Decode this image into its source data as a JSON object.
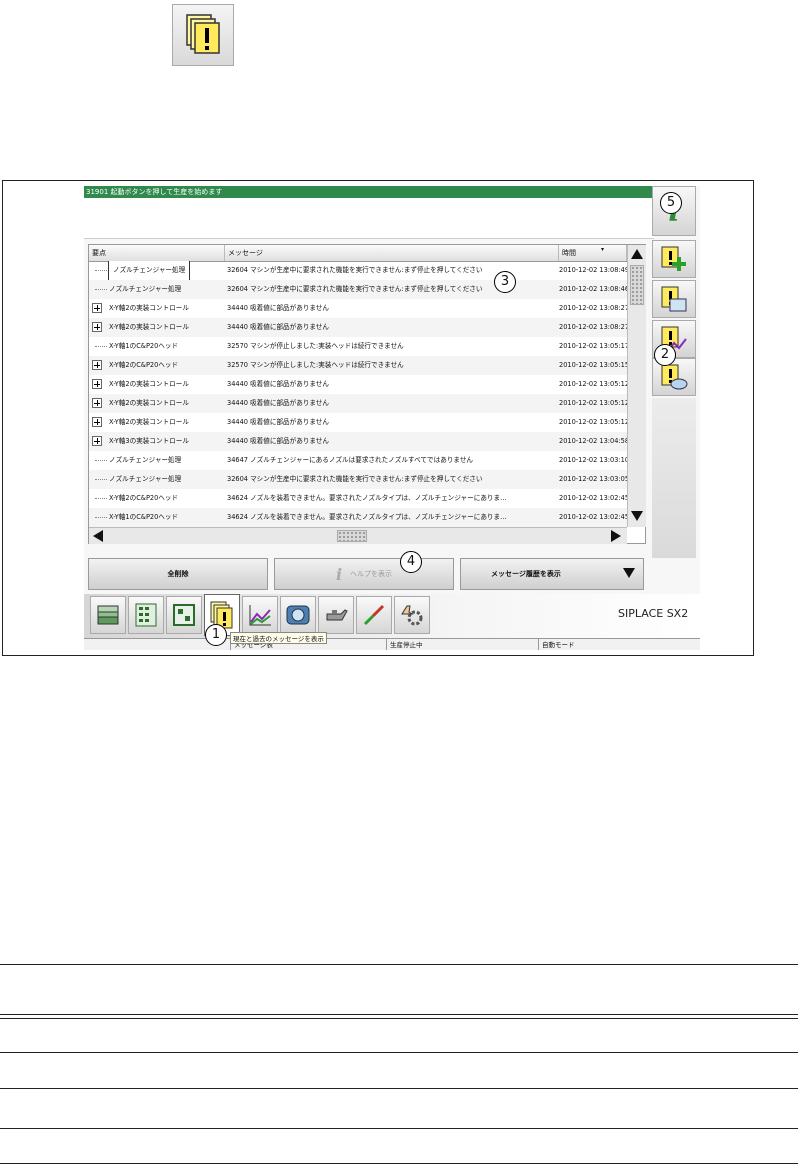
{
  "header_message": "31901 起動ボタンを押して生産を始めます",
  "table": {
    "columns": {
      "source": "要点",
      "message": "メッセージ",
      "time": "時間"
    },
    "rows": [
      {
        "expandable": false,
        "source": "ノズルチェンジャー処理",
        "message": "32604 マシンが生産中に要求された機能を実行できません:まず停止を押してください",
        "time": "2010-12-02 13:08:49",
        "selected": true
      },
      {
        "expandable": false,
        "source": "ノズルチェンジャー処理",
        "message": "32604 マシンが生産中に要求された機能を実行できません:まず停止を押してください",
        "time": "2010-12-02 13:08:46"
      },
      {
        "expandable": true,
        "source": "X-Y軸2の実装コントロール",
        "message": "34440 吸着値に部品がありません",
        "time": "2010-12-02 13:08:27"
      },
      {
        "expandable": true,
        "source": "X-Y軸2の実装コントロール",
        "message": "34440 吸着値に部品がありません",
        "time": "2010-12-02 13:08:27"
      },
      {
        "expandable": false,
        "source": "X-Y軸1のC&P20ヘッド",
        "message": "32570 マシンが停止しました:実装ヘッドは続行できません",
        "time": "2010-12-02 13:05:17"
      },
      {
        "expandable": true,
        "source": "X-Y軸2のC&P20ヘッド",
        "message": "32570 マシンが停止しました:実装ヘッドは続行できません",
        "time": "2010-12-02 13:05:15"
      },
      {
        "expandable": true,
        "source": "X-Y軸2の実装コントロール",
        "message": "34440 吸着値に部品がありません",
        "time": "2010-12-02 13:05:12"
      },
      {
        "expandable": true,
        "source": "X-Y軸2の実装コントロール",
        "message": "34440 吸着値に部品がありません",
        "time": "2010-12-02 13:05:12"
      },
      {
        "expandable": true,
        "source": "X-Y軸2の実装コントロール",
        "message": "34440 吸着値に部品がありません",
        "time": "2010-12-02 13:05:12"
      },
      {
        "expandable": true,
        "source": "X-Y軸3の実装コントロール",
        "message": "34440 吸着値に部品がありません",
        "time": "2010-12-02 13:04:58"
      },
      {
        "expandable": false,
        "source": "ノズルチェンジャー処理",
        "message": "34647 ノズルチェンジャーにあるノズルは要求されたノズルすべてではありません",
        "time": "2010-12-02 13:03:10"
      },
      {
        "expandable": false,
        "source": "ノズルチェンジャー処理",
        "message": "32604 マシンが生産中に要求された機能を実行できません:まず停止を押してください",
        "time": "2010-12-02 13:03:05"
      },
      {
        "expandable": false,
        "source": "X-Y軸2のC&P20ヘッド",
        "message": "34624 ノズルを装着できません。要求されたノズルタイプは、ノズルチェンジャーにありま…",
        "time": "2010-12-02 13:02:45"
      },
      {
        "expandable": false,
        "source": "X-Y軸1のC&P20ヘッド",
        "message": "34624 ノズルを装着できません。要求されたノズルタイプは、ノズルチェンジャーにありま…",
        "time": "2010-12-02 13:02:45"
      }
    ]
  },
  "buttons": {
    "delete_all": "全削除",
    "show_help": "ヘルプを表示",
    "show_history": "メッセージ履歴を表示"
  },
  "brand": "SIPLACE SX2",
  "tooltip": "現在と過去のメッセージを表示",
  "status": {
    "seg1": "メッセージ表",
    "seg2": "生産停止中",
    "seg3": "自動モード"
  },
  "callouts": {
    "c1": "1",
    "c2": "2",
    "c3": "3",
    "c4": "4",
    "c5": "5"
  },
  "colors": {
    "header_green": "#2f8a4c",
    "info_green": "#2e8b3a",
    "plus_green": "#2aa02a"
  },
  "icons": {
    "top": "exclamation-message-icon",
    "toolbar": [
      "feeder-icon",
      "board-grid-icon",
      "layout-icon",
      "messages-icon",
      "chart-icon",
      "camera-icon",
      "oil-can-icon",
      "wire-tool-icon",
      "hand-gear-icon"
    ],
    "side": [
      "info-icon",
      "add-message-icon",
      "message-window-icon",
      "message-stats-icon",
      "message-hand-icon"
    ]
  }
}
